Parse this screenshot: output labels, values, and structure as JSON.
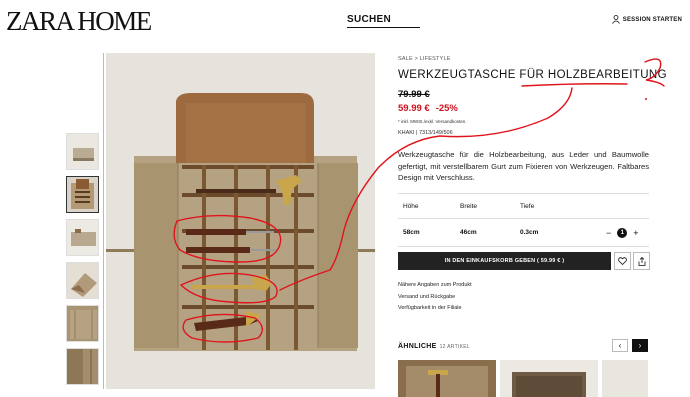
{
  "header": {
    "logo": "ZARA HOME",
    "search_label": "SUCHEN",
    "login_label": "SESSION STARTEN"
  },
  "product": {
    "breadcrumb": [
      "SALE",
      "LIFESTYLE"
    ],
    "title": "WERKZEUGTASCHE FÜR HOLZBEARBEITUNG",
    "old_price": "79.99 €",
    "new_price": "59.99 €",
    "discount": "-25%",
    "vat_note": "* inkl. MWSt./exkl. Versandkosten.",
    "color_ref": "KHAKI | 7313/149/506",
    "description": "Werkzeugtasche für die Holzbearbeitung, aus Leder und Baumwolle gefertigt, mit verstellbarem Gurt zum Fixieren von Werkzeugen. Faltbares Design mit Verschluss.",
    "dimensions": {
      "headers": [
        "Höhe",
        "Breite",
        "Tiefe"
      ],
      "values": [
        "58cm",
        "46cm",
        "0.3cm"
      ]
    },
    "quantity": "1",
    "add_to_cart": "IN DEN EINKAUFSKORB GEBEN ( 59.99 € )",
    "links": [
      "Nähere Angaben zum Produkt",
      "Versand und Rückgabe",
      "Verfügbarkeit in der Filiale"
    ]
  },
  "similar": {
    "title": "ÄHNLICHE",
    "count": "12 ARTIKEL"
  },
  "icons": {
    "user": "user-icon",
    "heart": "heart-icon",
    "share": "share-icon",
    "prev": "chevron-left-icon",
    "next": "chevron-right-icon"
  },
  "colors": {
    "sale_red": "#d0101e",
    "annotation_red": "#e0141c",
    "button_dark": "#222222"
  }
}
